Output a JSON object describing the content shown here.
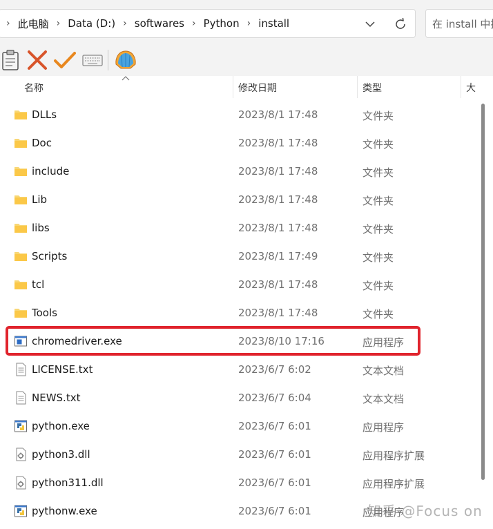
{
  "breadcrumb": [
    "此电脑",
    "Data (D:)",
    "softwares",
    "Python",
    "install"
  ],
  "search": {
    "placeholder": "在 install 中搜"
  },
  "columns": {
    "name": "名称",
    "modified": "修改日期",
    "type": "类型",
    "size": "大"
  },
  "files": [
    {
      "name": "DLLs",
      "modified": "2023/8/1 17:48",
      "type": "文件夹",
      "icon": "folder-icon"
    },
    {
      "name": "Doc",
      "modified": "2023/8/1 17:48",
      "type": "文件夹",
      "icon": "folder-icon"
    },
    {
      "name": "include",
      "modified": "2023/8/1 17:48",
      "type": "文件夹",
      "icon": "folder-icon"
    },
    {
      "name": "Lib",
      "modified": "2023/8/1 17:48",
      "type": "文件夹",
      "icon": "folder-icon"
    },
    {
      "name": "libs",
      "modified": "2023/8/1 17:48",
      "type": "文件夹",
      "icon": "folder-icon"
    },
    {
      "name": "Scripts",
      "modified": "2023/8/1 17:49",
      "type": "文件夹",
      "icon": "folder-icon"
    },
    {
      "name": "tcl",
      "modified": "2023/8/1 17:48",
      "type": "文件夹",
      "icon": "folder-icon"
    },
    {
      "name": "Tools",
      "modified": "2023/8/1 17:48",
      "type": "文件夹",
      "icon": "folder-icon"
    },
    {
      "name": "chromedriver.exe",
      "modified": "2023/8/10 17:16",
      "type": "应用程序",
      "icon": "exe-icon",
      "highlighted": true
    },
    {
      "name": "LICENSE.txt",
      "modified": "2023/6/7 6:02",
      "type": "文本文档",
      "icon": "text-file-icon"
    },
    {
      "name": "NEWS.txt",
      "modified": "2023/6/7 6:04",
      "type": "文本文档",
      "icon": "text-file-icon"
    },
    {
      "name": "python.exe",
      "modified": "2023/6/7 6:01",
      "type": "应用程序",
      "icon": "python-exe-icon"
    },
    {
      "name": "python3.dll",
      "modified": "2023/6/7 6:01",
      "type": "应用程序扩展",
      "icon": "dll-icon"
    },
    {
      "name": "python311.dll",
      "modified": "2023/6/7 6:01",
      "type": "应用程序扩展",
      "icon": "dll-icon"
    },
    {
      "name": "pythonw.exe",
      "modified": "2023/6/7 6:01",
      "type": "应用程序",
      "icon": "python-exe-icon"
    }
  ],
  "toolbar_icons": [
    "clipboard-icon",
    "delete-x-icon",
    "checkmark-icon",
    "keyboard-icon",
    "shell-icon"
  ],
  "highlight_color": "#e0242d",
  "watermark": "知乎 @Focus on"
}
